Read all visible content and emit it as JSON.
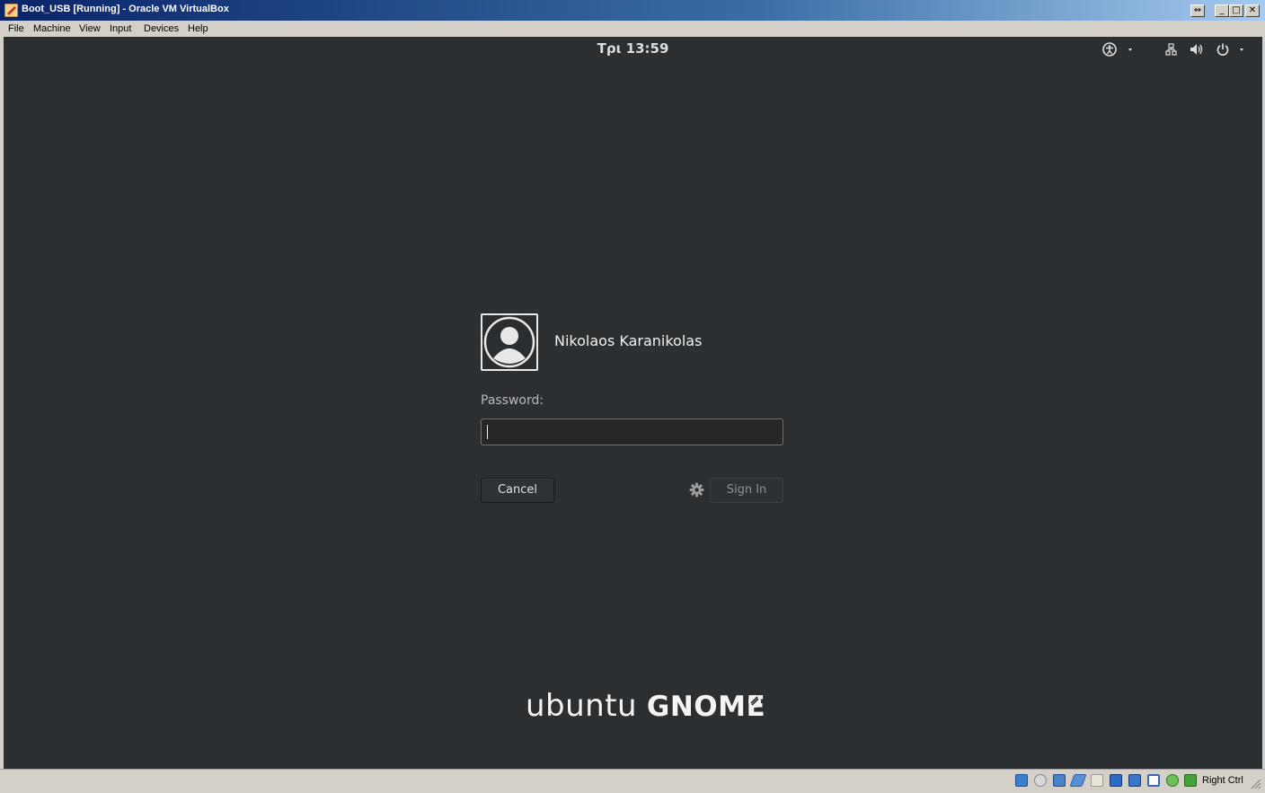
{
  "window": {
    "title": "Boot_USB [Running] - Oracle VM VirtualBox",
    "buttons": {
      "restore": "⇔",
      "minimize": "_",
      "maximize": "□",
      "close": "✕"
    }
  },
  "menubar": {
    "items": [
      "File",
      "Machine",
      "View",
      "Input",
      "Devices",
      "Help"
    ]
  },
  "top_panel": {
    "clock": "Τρι 13:59",
    "icons": [
      "accessibility-icon",
      "network-icon",
      "volume-icon",
      "power-icon"
    ]
  },
  "login": {
    "user_name": "Nikolaos Karanikolas",
    "password_label": "Password:",
    "password_value": "",
    "cancel_label": "Cancel",
    "sign_in_label": "Sign In"
  },
  "branding": {
    "light": "ubuntu",
    "bold": "GNOME"
  },
  "statusbar": {
    "host_key": "Right Ctrl",
    "icons": [
      "hard-disk-icon",
      "optical-drive-icon",
      "audio-icon",
      "network-adapter-icon",
      "usb-icon",
      "shared-folders-icon",
      "display-icon",
      "video-capture-icon",
      "recording-icon",
      "cpu-icon",
      "mouse-integration-icon",
      "keyboard-icon"
    ]
  },
  "colors": {
    "desktop": "#2b2e31",
    "titlebar_start": "#0a246a",
    "titlebar_end": "#a6caf0"
  }
}
